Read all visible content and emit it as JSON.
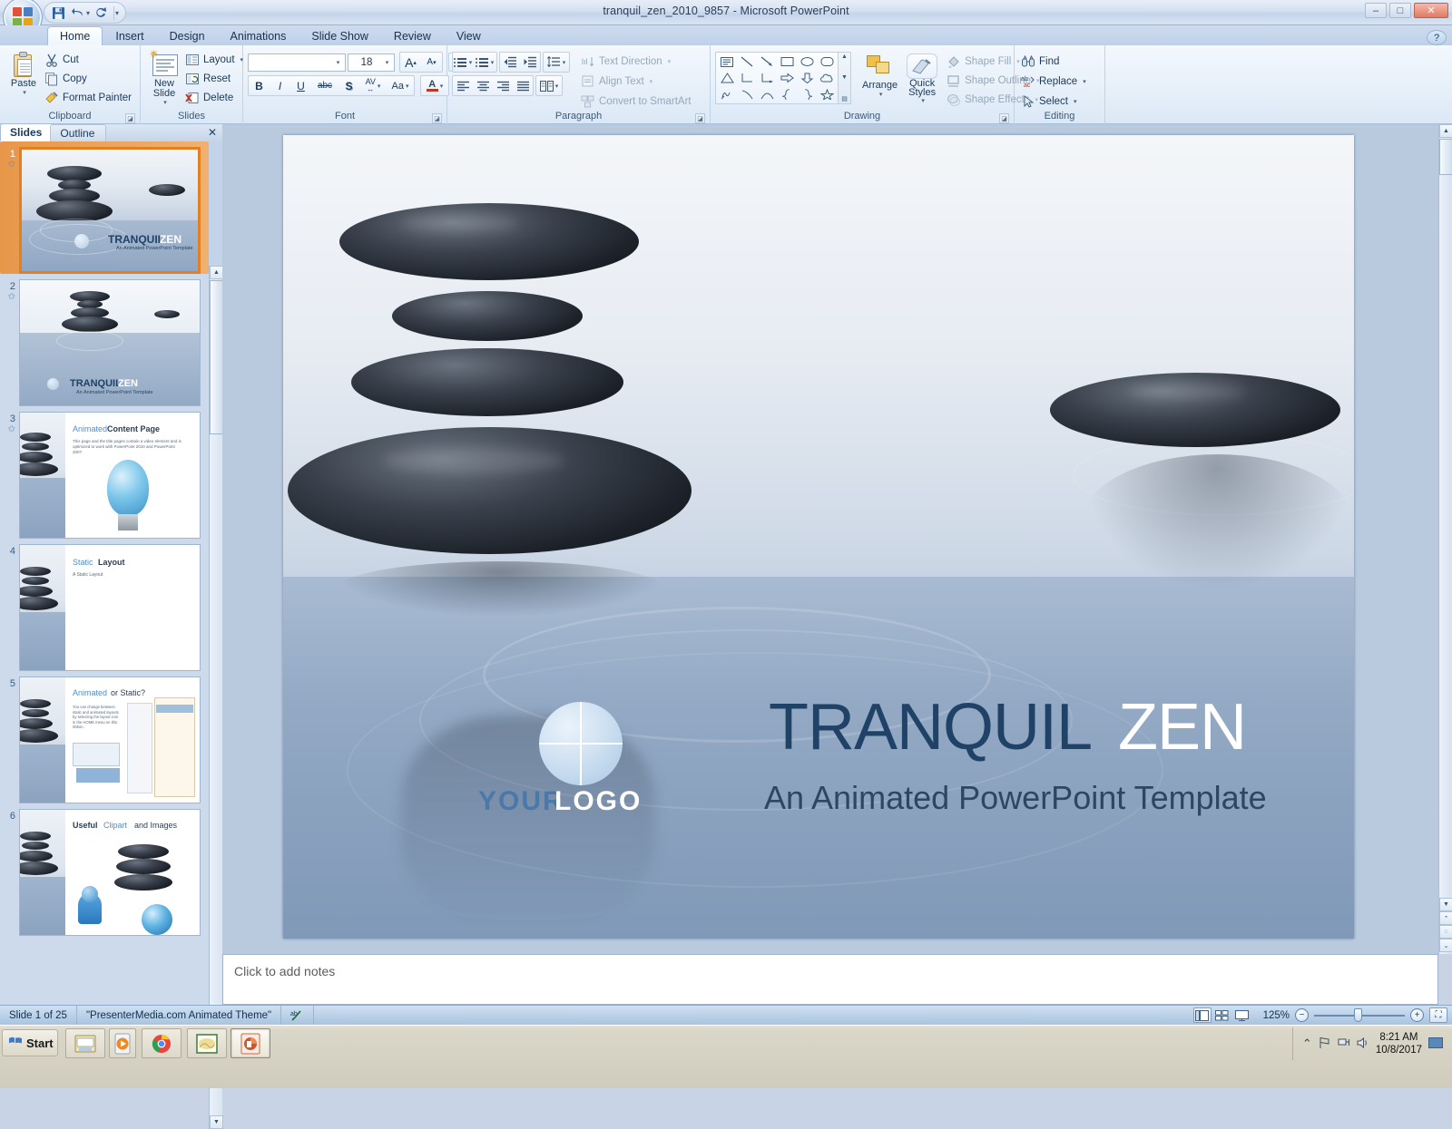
{
  "window": {
    "title": "tranquil_zen_2010_9857 - Microsoft PowerPoint",
    "minimize": "–",
    "maximize": "□",
    "close": "✕"
  },
  "quick_access": {
    "save": "💾",
    "undo": "↺",
    "redo": "↻",
    "customize": "▾"
  },
  "ribbon": {
    "tabs": [
      {
        "label": "Home",
        "active": true
      },
      {
        "label": "Insert",
        "active": false
      },
      {
        "label": "Design",
        "active": false
      },
      {
        "label": "Animations",
        "active": false
      },
      {
        "label": "Slide Show",
        "active": false
      },
      {
        "label": "Review",
        "active": false
      },
      {
        "label": "View",
        "active": false
      }
    ],
    "help_icon": "?",
    "groups": {
      "clipboard": {
        "label": "Clipboard",
        "paste": "Paste",
        "cut": "Cut",
        "copy": "Copy",
        "format_painter": "Format Painter"
      },
      "slides": {
        "label": "Slides",
        "new_slide": "New Slide",
        "layout": "Layout",
        "reset": "Reset",
        "delete": "Delete"
      },
      "font": {
        "label": "Font",
        "font_name": "",
        "font_name_placeholder": "",
        "font_size": "18",
        "grow": "A",
        "shrink": "A",
        "clear_formatting": "Aa",
        "bold": "B",
        "italic": "I",
        "underline": "U",
        "strikethrough": "abc",
        "shadow": "S",
        "character_spacing": "AV",
        "change_case": "Aa",
        "font_color": "A"
      },
      "paragraph": {
        "label": "Paragraph",
        "text_direction": "Text Direction",
        "align_text": "Align Text",
        "convert_smartart": "Convert to SmartArt"
      },
      "drawing": {
        "label": "Drawing",
        "arrange": "Arrange",
        "quick_styles": "Quick Styles",
        "shape_fill": "Shape Fill",
        "shape_outline": "Shape Outline",
        "shape_effects": "Shape Effects"
      },
      "editing": {
        "label": "Editing",
        "find": "Find",
        "replace": "Replace",
        "select": "Select"
      }
    }
  },
  "left_pane": {
    "tab_slides": "Slides",
    "tab_outline": "Outline",
    "close": "✕",
    "thumbnails": [
      {
        "num": "1",
        "title_a": "TRANQUIL",
        "title_b": "ZEN",
        "sub": "An Animated PowerPoint Template",
        "kind": "title",
        "selected": true
      },
      {
        "num": "2",
        "title_a": "TRANQUIL",
        "title_b": "ZEN",
        "sub": "An Animated PowerPoint Template",
        "kind": "title2",
        "selected": false
      },
      {
        "num": "3",
        "title_a": "Animated",
        "title_b": "Content Page",
        "sub": "This page and the title pages contain a video element and is optimized to work with PowerPoint 2010 and PowerPoint 2007.",
        "kind": "content",
        "selected": false
      },
      {
        "num": "4",
        "title_a": "Static",
        "title_b": "Layout",
        "sub": "A Static Layout",
        "kind": "static",
        "selected": false
      },
      {
        "num": "5",
        "title_a": "Animated",
        "title_b": "or Static?",
        "sub": "You can change between static and animated layouts by selecting the layout icon in the HOME menu on this ribbon.",
        "kind": "compare",
        "selected": false
      },
      {
        "num": "6",
        "title_a": "Useful",
        "title_b": "Clipart",
        "title_c": "and Images",
        "sub": "",
        "kind": "clipart",
        "selected": false
      }
    ]
  },
  "slide": {
    "title_main": "TRANQUIL",
    "title_accent": "ZEN",
    "subtitle": "An Animated PowerPoint Template",
    "logo_your": "YOUR",
    "logo_logo": "LOGO",
    "colors": {
      "title_main": "#1f4266",
      "title_accent": "#ffffff",
      "subtitle": "#2e4660",
      "logo_your": "#4a78a8",
      "logo_logo": "#ffffff"
    }
  },
  "notes": {
    "placeholder": "Click to add notes"
  },
  "status_bar": {
    "slide_count": "Slide 1 of 25",
    "theme": "\"PresenterMedia.com Animated Theme\"",
    "spellcheck_icon": "spell-check-icon",
    "view_normal": "normal-view",
    "view_sorter": "slide-sorter-view",
    "view_show": "slide-show-view",
    "zoom": "125%",
    "zoom_out": "−",
    "zoom_in": "+",
    "fit_window": "⛶"
  },
  "taskbar": {
    "start": "Start",
    "items": [
      {
        "name": "explorer-taskbar-item",
        "active": false
      },
      {
        "name": "media-player-taskbar-item",
        "active": false
      },
      {
        "name": "chrome-taskbar-item",
        "active": false
      },
      {
        "name": "image-viewer-taskbar-item",
        "active": false
      },
      {
        "name": "powerpoint-taskbar-item",
        "active": true
      }
    ],
    "tray": {
      "show_hidden": "⌃",
      "flag_icon": "⚑",
      "network_icon": "🖧",
      "volume_icon": "🔊",
      "time": "8:21 AM",
      "date": "10/8/2017"
    }
  }
}
